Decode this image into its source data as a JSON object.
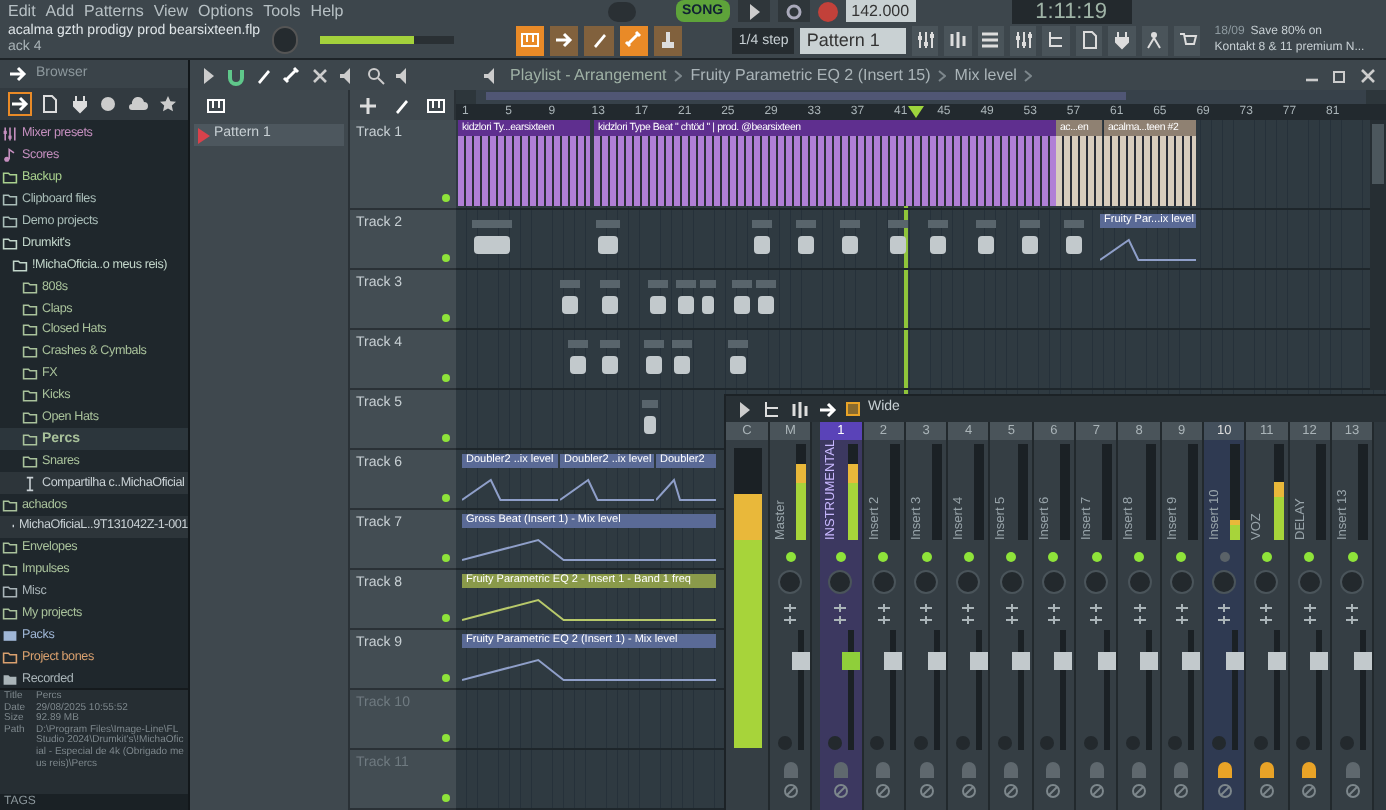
{
  "menu": [
    "Edit",
    "Add",
    "Patterns",
    "View",
    "Options",
    "Tools",
    "Help"
  ],
  "transport": {
    "mode": "SONG",
    "tempo": "142.000",
    "time": "1:11:19"
  },
  "project": {
    "filename": "acalma gzth prodigy prod bearsixteen.flp",
    "hint": "ack 4"
  },
  "master_volume": {
    "level": 0.7
  },
  "snap": "1/4 step",
  "pattern": "Pattern 1",
  "news": {
    "date": "18/09",
    "line1": "Save 80% on",
    "line2": "Kontakt 8 & 11 premium N..."
  },
  "browser": {
    "title": "Browser",
    "tabs": [
      {
        "selected": true
      },
      {
        "selected": false
      },
      {
        "selected": false
      },
      {
        "selected": false
      },
      {
        "selected": false
      },
      {
        "selected": false
      }
    ],
    "items": [
      {
        "kind": "presets",
        "label": "Mixer presets",
        "color": "#c58fbf",
        "selected": false
      },
      {
        "kind": "score",
        "label": "Scores",
        "color": "#c58fbf",
        "selected": false
      },
      {
        "kind": "folder",
        "label": "Backup",
        "color": "#a9d18e",
        "selected": false
      },
      {
        "kind": "folder",
        "label": "Clipboard files",
        "color": "#a9bdb8",
        "selected": false
      },
      {
        "kind": "folder",
        "label": "Demo projects",
        "color": "#a9bdb8",
        "selected": false
      },
      {
        "kind": "folder",
        "label": "Drumkit's",
        "color": "#c2d6ca",
        "selected": false,
        "expanded": true,
        "children": [
          {
            "kind": "folder",
            "label": "!MichaOficia..o meus reis)",
            "color": "#c2d6ca",
            "selected": false,
            "expanded": true,
            "children": [
              {
                "kind": "folder",
                "label": "808s",
                "color": "#a9c29b",
                "selected": false
              },
              {
                "kind": "folder",
                "label": "Claps",
                "color": "#a9c29b",
                "selected": false
              },
              {
                "kind": "folder",
                "label": "Closed Hats",
                "color": "#a9c29b",
                "selected": false
              },
              {
                "kind": "folder",
                "label": "Crashes & Cymbals",
                "color": "#a9c29b",
                "selected": false
              },
              {
                "kind": "folder",
                "label": "FX",
                "color": "#a9c29b",
                "selected": false
              },
              {
                "kind": "folder",
                "label": "Kicks",
                "color": "#a9c29b",
                "selected": false
              },
              {
                "kind": "folder",
                "label": "Open Hats",
                "color": "#a9c29b",
                "selected": false
              },
              {
                "kind": "folder",
                "label": "Percs",
                "color": "#a9c29b",
                "selected": true
              },
              {
                "kind": "folder",
                "label": "Snares",
                "color": "#a9c29b",
                "selected": false
              },
              {
                "kind": "text_file",
                "label": "Compartilha c..MichaOficial",
                "color": "#c8d0d4",
                "selected": false
              }
            ]
          }
        ]
      },
      {
        "kind": "folder",
        "label": "achados",
        "color": "#a9c29b",
        "selected": false,
        "expanded": true,
        "children": [
          {
            "kind": "file",
            "label": "MichaOficiaL..9T131042Z-1-001",
            "color": "#c8d0d4",
            "selected": false
          }
        ]
      },
      {
        "kind": "folder",
        "label": "Envelopes",
        "color": "#a9c29b",
        "selected": false
      },
      {
        "kind": "folder",
        "label": "Impulses",
        "color": "#a9c29b",
        "selected": false
      },
      {
        "kind": "folder",
        "label": "Misc",
        "color": "#a9b4b8",
        "selected": false
      },
      {
        "kind": "folder",
        "label": "My projects",
        "color": "#a9c29b",
        "selected": false
      },
      {
        "kind": "packs",
        "label": "Packs",
        "color": "#9fb6d6",
        "selected": false
      },
      {
        "kind": "folder",
        "label": "Project bones",
        "color": "#d9a06e",
        "selected": false
      },
      {
        "kind": "recorded",
        "label": "Recorded",
        "color": "#a9b4b8",
        "selected": false
      }
    ],
    "info": [
      {
        "label": "Title",
        "value": "Percs"
      },
      {
        "label": "Date",
        "value": "29/08/2025 10:55:52"
      },
      {
        "label": "Size",
        "value": "92.89 MB"
      },
      {
        "label": "Path",
        "value": "D:\\Program Files\\Image-Line\\FL Studio 2024\\Drumkit's\\!MichaOficial - Especial de 4k (Obrigado meus reis)\\Percs"
      }
    ],
    "tags": "TAGS"
  },
  "playlist": {
    "breadcrumb": [
      "Playlist - Arrangement",
      "Fruity Parametric EQ 2 (Insert 15)",
      "Mix level"
    ],
    "patterns": [
      {
        "label": "Pattern 1",
        "selected": true
      }
    ],
    "ruler": [
      "1",
      "5",
      "9",
      "13",
      "17",
      "21",
      "25",
      "29",
      "33",
      "37",
      "41",
      "45",
      "49",
      "53",
      "57",
      "61",
      "65",
      "69",
      "73",
      "77",
      "81"
    ],
    "tracks": [
      {
        "name": "Track 1",
        "dimmed": false,
        "clips": [
          {
            "kind": "audio",
            "label": "kidzlori Ty...earsixteen",
            "color": "#b07fd6"
          },
          {
            "kind": "audio",
            "label": "kidzlori Type Beat  \" chtöd \"  |  prod. @bearsixteen",
            "color": "#b07fd6"
          },
          {
            "kind": "audio",
            "label": "ac...en",
            "color": "#d8cdbd"
          },
          {
            "kind": "audio",
            "label": "acalma...teen #2",
            "color": "#d8cdbd"
          }
        ]
      },
      {
        "name": "Track 2",
        "dimmed": false,
        "clips": [
          {
            "kind": "samples"
          },
          {
            "kind": "automation",
            "label": "Fruity Par...ix level",
            "color": "#5a6a96"
          }
        ]
      },
      {
        "name": "Track 3",
        "dimmed": false,
        "clips": [
          {
            "kind": "samples"
          }
        ]
      },
      {
        "name": "Track 4",
        "dimmed": false,
        "clips": [
          {
            "kind": "samples"
          }
        ]
      },
      {
        "name": "Track 5",
        "dimmed": false,
        "clips": [
          {
            "kind": "samples"
          }
        ]
      },
      {
        "name": "Track 6",
        "dimmed": false,
        "clips": [
          {
            "kind": "automation",
            "label": "Doubler2 ..ix level",
            "color": "#5a6a96"
          },
          {
            "kind": "automation",
            "label": "Doubler2 ..ix level",
            "color": "#5a6a96"
          },
          {
            "kind": "automation",
            "label": "Doubler2",
            "color": "#5a6a96"
          }
        ]
      },
      {
        "name": "Track 7",
        "dimmed": false,
        "clips": [
          {
            "kind": "automation",
            "label": "Gross Beat (Insert 1) - Mix level",
            "color": "#5a6a96"
          }
        ]
      },
      {
        "name": "Track 8",
        "dimmed": false,
        "clips": [
          {
            "kind": "automation",
            "label": "Fruity Parametric EQ 2 - Insert 1 - Band 1 freq",
            "color": "#8a9a4a"
          }
        ]
      },
      {
        "name": "Track 9",
        "dimmed": false,
        "clips": [
          {
            "kind": "automation",
            "label": "Fruity Parametric EQ 2 (Insert 1) - Mix level",
            "color": "#5a6a96"
          }
        ]
      },
      {
        "name": "Track 10",
        "dimmed": true
      },
      {
        "name": "Track 11",
        "dimmed": true
      }
    ]
  },
  "mixer": {
    "preset": "Wide",
    "channels": [
      {
        "number": "C",
        "kind": "current",
        "meter": {
          "level": 0.85
        }
      },
      {
        "number": "M",
        "name": "Master",
        "kind": "insert",
        "selected": false,
        "focused": false,
        "fx_on": true,
        "send_active": false,
        "meter": {
          "level": 0.8
        },
        "fader": {
          "level": 0.75
        }
      },
      {
        "number": "1",
        "name": "INSTRUMENTAL",
        "kind": "insert",
        "selected": true,
        "focused": false,
        "fx_on": true,
        "send_active": false,
        "meter": {
          "level": 0.8
        },
        "fader": {
          "level": 0.75
        }
      },
      {
        "number": "2",
        "name": "Insert 2",
        "kind": "insert",
        "selected": false,
        "focused": false,
        "fx_on": true,
        "send_active": false,
        "meter": {
          "level": 0
        },
        "fader": {
          "level": 0.75
        }
      },
      {
        "number": "3",
        "name": "Insert 3",
        "kind": "insert",
        "selected": false,
        "focused": false,
        "fx_on": true,
        "send_active": false,
        "meter": {
          "level": 0
        },
        "fader": {
          "level": 0.75
        }
      },
      {
        "number": "4",
        "name": "Insert 4",
        "kind": "insert",
        "selected": false,
        "focused": false,
        "fx_on": true,
        "send_active": false,
        "meter": {
          "level": 0
        },
        "fader": {
          "level": 0.75
        }
      },
      {
        "number": "5",
        "name": "Insert 5",
        "kind": "insert",
        "selected": false,
        "focused": false,
        "fx_on": true,
        "send_active": false,
        "meter": {
          "level": 0
        },
        "fader": {
          "level": 0.75
        }
      },
      {
        "number": "6",
        "name": "Insert 6",
        "kind": "insert",
        "selected": false,
        "focused": false,
        "fx_on": true,
        "send_active": false,
        "meter": {
          "level": 0
        },
        "fader": {
          "level": 0.75
        }
      },
      {
        "number": "7",
        "name": "Insert 7",
        "kind": "insert",
        "selected": false,
        "focused": false,
        "fx_on": true,
        "send_active": false,
        "meter": {
          "level": 0
        },
        "fader": {
          "level": 0.75
        }
      },
      {
        "number": "8",
        "name": "Insert 8",
        "kind": "insert",
        "selected": false,
        "focused": false,
        "fx_on": true,
        "send_active": false,
        "meter": {
          "level": 0
        },
        "fader": {
          "level": 0.75
        }
      },
      {
        "number": "9",
        "name": "Insert 9",
        "kind": "insert",
        "selected": false,
        "focused": false,
        "fx_on": true,
        "send_active": false,
        "meter": {
          "level": 0
        },
        "fader": {
          "level": 0.75
        }
      },
      {
        "number": "10",
        "name": "Insert 10",
        "kind": "insert",
        "selected": false,
        "focused": true,
        "fx_on": false,
        "send_active": true,
        "meter": {
          "level": 0.2
        },
        "fader": {
          "level": 0.75
        }
      },
      {
        "number": "11",
        "name": "VOZ",
        "kind": "insert",
        "selected": false,
        "focused": false,
        "fx_on": true,
        "send_active": true,
        "meter": {
          "level": 0.6
        },
        "fader": {
          "level": 0.75
        }
      },
      {
        "number": "12",
        "name": "DELAY",
        "kind": "insert",
        "selected": false,
        "focused": false,
        "fx_on": true,
        "send_active": true,
        "meter": {
          "level": 0
        },
        "fader": {
          "level": 0.75
        }
      },
      {
        "number": "13",
        "name": "Insert 13",
        "kind": "insert",
        "selected": false,
        "focused": false,
        "fx_on": true,
        "send_active": false,
        "meter": {
          "level": 0
        },
        "fader": {
          "level": 0.75
        }
      }
    ]
  }
}
